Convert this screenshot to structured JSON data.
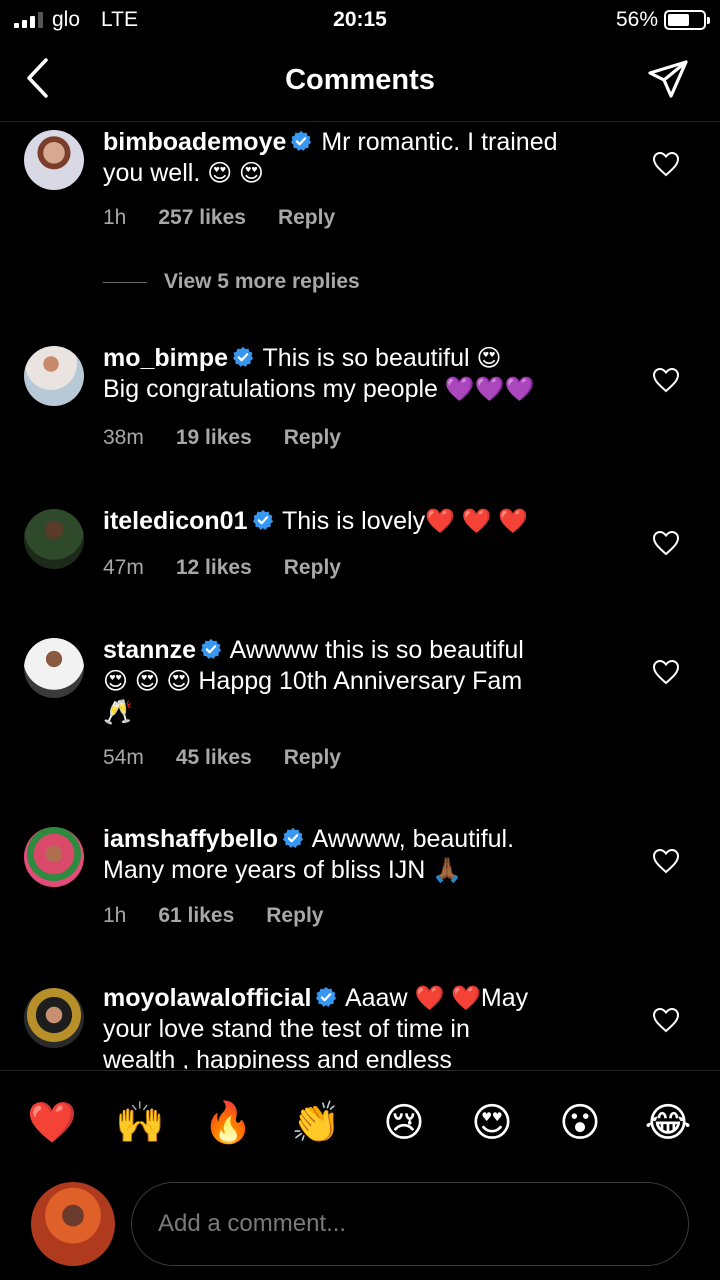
{
  "status_bar": {
    "carrier": "glo",
    "network": "LTE",
    "time": "20:15",
    "battery_percent": "56%"
  },
  "header": {
    "title": "Comments",
    "back_icon": "chevron-left-icon",
    "share_icon": "paper-plane-icon"
  },
  "comments": [
    {
      "username": "bimboademoye",
      "verified": true,
      "line1": "Mr romantic.  I trained",
      "line2": "you well.",
      "line2_emoji": "😍 😍",
      "time": "1h",
      "likes": "257 likes",
      "reply": "Reply"
    },
    {
      "username": "mo_bimpe",
      "verified": true,
      "line1": "This is so beautiful",
      "line1_emoji": "😍",
      "line2": "Big congratulations my people",
      "line2_emoji": "💜💜💜",
      "time": "38m",
      "likes": "19 likes",
      "reply": "Reply"
    },
    {
      "username": "iteledicon01",
      "verified": true,
      "line1": "This is lovely",
      "line1_emoji": "❤️ ❤️ ❤️",
      "time": "47m",
      "likes": "12 likes",
      "reply": "Reply"
    },
    {
      "username": "stannze",
      "verified": true,
      "line1": "Awwww this is so beautiful",
      "line2_emoji": "😍 😍 😍",
      "line2": "Happg 10th Anniversary Fam",
      "line3_emoji": "🥂",
      "time": "54m",
      "likes": "45 likes",
      "reply": "Reply"
    },
    {
      "username": "iamshaffybello",
      "verified": true,
      "line1": "Awwww, beautiful.",
      "line2": "Many more years of bliss IJN",
      "line2_emoji": "🙏🏾",
      "time": "1h",
      "likes": "61 likes",
      "reply": "Reply"
    },
    {
      "username": "moyolawalofficial",
      "verified": true,
      "line1": "Aaaw",
      "line1_emoji": "❤️ ❤️",
      "line1_tail": "May",
      "line2": "your love stand the test of time in",
      "line3": "wealth , happiness and endless"
    }
  ],
  "view_replies": "View 5 more replies",
  "quick_reactions": [
    "❤️",
    "🙌",
    "🔥",
    "👏",
    "😢",
    "😍",
    "😮",
    "😂"
  ],
  "composer": {
    "placeholder": "Add a comment..."
  },
  "colors": {
    "background": "#000000",
    "secondary_text": "#a8a8a8",
    "verified_blue": "#3897f0"
  }
}
